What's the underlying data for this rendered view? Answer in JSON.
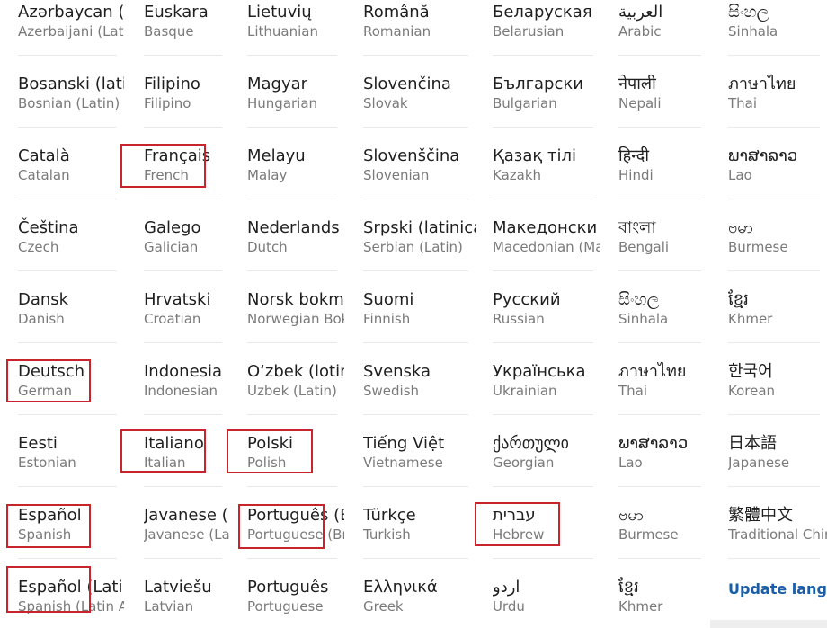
{
  "columns": [
    [
      {
        "name": "Azərbaycan (latin)",
        "sub": "Azerbaijani (Latin)"
      },
      {
        "name": "Bosanski (latinica)",
        "sub": "Bosnian (Latin)"
      },
      {
        "name": "Català",
        "sub": "Catalan"
      },
      {
        "name": "Čeština",
        "sub": "Czech"
      },
      {
        "name": "Dansk",
        "sub": "Danish"
      },
      {
        "name": "Deutsch",
        "sub": "German",
        "highlighted": true
      },
      {
        "name": "Eesti",
        "sub": "Estonian"
      },
      {
        "name": "Español",
        "sub": "Spanish",
        "highlighted": true
      },
      {
        "name": "Español (Latinoamérica)",
        "sub": "Spanish (Latin America)",
        "highlighted": true
      }
    ],
    [
      {
        "name": "Euskara",
        "sub": "Basque"
      },
      {
        "name": "Filipino",
        "sub": "Filipino"
      },
      {
        "name": "Français",
        "sub": "French",
        "highlighted": true
      },
      {
        "name": "Galego",
        "sub": "Galician"
      },
      {
        "name": "Hrvatski",
        "sub": "Croatian"
      },
      {
        "name": "Indonesia",
        "sub": "Indonesian"
      },
      {
        "name": "Italiano",
        "sub": "Italian",
        "highlighted": true
      },
      {
        "name": "Javanese (Latin)",
        "sub": "Javanese (Latin)"
      },
      {
        "name": "Latviešu",
        "sub": "Latvian"
      }
    ],
    [
      {
        "name": "Lietuvių",
        "sub": "Lithuanian"
      },
      {
        "name": "Magyar",
        "sub": "Hungarian"
      },
      {
        "name": "Melayu",
        "sub": "Malay"
      },
      {
        "name": "Nederlands",
        "sub": "Dutch"
      },
      {
        "name": "Norsk bokmål",
        "sub": "Norwegian Bokmål"
      },
      {
        "name": "O‘zbek (lotin)",
        "sub": "Uzbek (Latin)"
      },
      {
        "name": "Polski",
        "sub": "Polish",
        "highlighted": true
      },
      {
        "name": "Português (Brasil)",
        "sub": "Portuguese (Brazil)",
        "highlighted": true
      },
      {
        "name": "Português",
        "sub": "Portuguese"
      }
    ],
    [
      {
        "name": "Română",
        "sub": "Romanian"
      },
      {
        "name": "Slovenčina",
        "sub": "Slovak"
      },
      {
        "name": "Slovenščina",
        "sub": "Slovenian"
      },
      {
        "name": "Srpski (latinica)",
        "sub": "Serbian (Latin)"
      },
      {
        "name": "Suomi",
        "sub": "Finnish"
      },
      {
        "name": "Svenska",
        "sub": "Swedish"
      },
      {
        "name": "Tiếng Việt",
        "sub": "Vietnamese"
      },
      {
        "name": "Türkçe",
        "sub": "Turkish"
      },
      {
        "name": "Ελληνικά",
        "sub": "Greek"
      }
    ],
    [
      {
        "name": "Беларуская",
        "sub": "Belarusian"
      },
      {
        "name": "Български",
        "sub": "Bulgarian"
      },
      {
        "name": "Қазақ тілі",
        "sub": "Kazakh"
      },
      {
        "name": "Македонски",
        "sub": "Macedonian (Macedonia)"
      },
      {
        "name": "Русский",
        "sub": "Russian"
      },
      {
        "name": "Українська",
        "sub": "Ukrainian"
      },
      {
        "name": "ქართული",
        "sub": "Georgian"
      },
      {
        "name": "עברית",
        "sub": "Hebrew",
        "highlighted": true
      },
      {
        "name": "اردو",
        "sub": "Urdu"
      }
    ],
    [
      {
        "name": "العربية",
        "sub": "Arabic"
      },
      {
        "name": "नेपाली",
        "sub": "Nepali"
      },
      {
        "name": "हिन्दी",
        "sub": "Hindi"
      },
      {
        "name": "বাংলা",
        "sub": "Bengali"
      },
      {
        "name": "සිංහල",
        "sub": "Sinhala"
      },
      {
        "name": "ภาษาไทย",
        "sub": "Thai"
      },
      {
        "name": "ພາສາລາວ",
        "sub": "Lao"
      },
      {
        "name": "ဗမာ",
        "sub": "Burmese"
      },
      {
        "name": "ខ្មែរ",
        "sub": "Khmer"
      }
    ],
    [
      {
        "name": "සිංහල",
        "sub": "Sinhala"
      },
      {
        "name": "ภาษาไทย",
        "sub": "Thai"
      },
      {
        "name": "ພາສາລາວ",
        "sub": "Lao"
      },
      {
        "name": "ဗမာ",
        "sub": "Burmese"
      },
      {
        "name": "ខ្មែរ",
        "sub": "Khmer"
      },
      {
        "name": "한국어",
        "sub": "Korean"
      },
      {
        "name": "日本語",
        "sub": "Japanese"
      },
      {
        "name": "繁體中文",
        "sub": "Traditional Chinese"
      }
    ]
  ],
  "update_button": {
    "label": "Update language"
  },
  "highlight_color": "#c8242b",
  "link_color": "#1a5ea8"
}
